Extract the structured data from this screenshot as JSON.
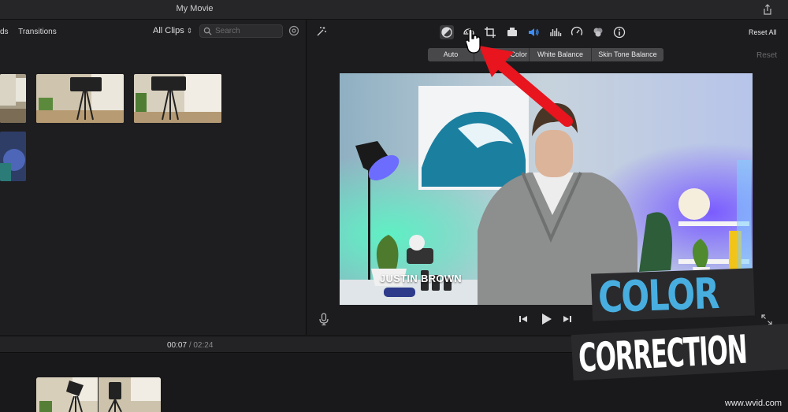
{
  "window": {
    "title": "My Movie"
  },
  "browser": {
    "tabs": [
      "ds",
      "Transitions"
    ],
    "clip_filter": "All Clips",
    "search_placeholder": "Search"
  },
  "viewer": {
    "reset_all": "Reset All",
    "reset": "Reset",
    "adjust_tabs": [
      "Auto",
      "Color",
      "White Balance",
      "Skin Tone Balance"
    ],
    "caption": "JUSTIN BROWN"
  },
  "timeline": {
    "current": "00:07",
    "separator": "/",
    "total": "02:24"
  },
  "overlay": {
    "line1": "COLOR",
    "line2": "CORRECTION"
  },
  "watermark": "www.wvid.com",
  "colors": {
    "accent_blue": "#48aee0",
    "arrow_red": "#e8141e",
    "volume_blue": "#3f8ef5"
  }
}
